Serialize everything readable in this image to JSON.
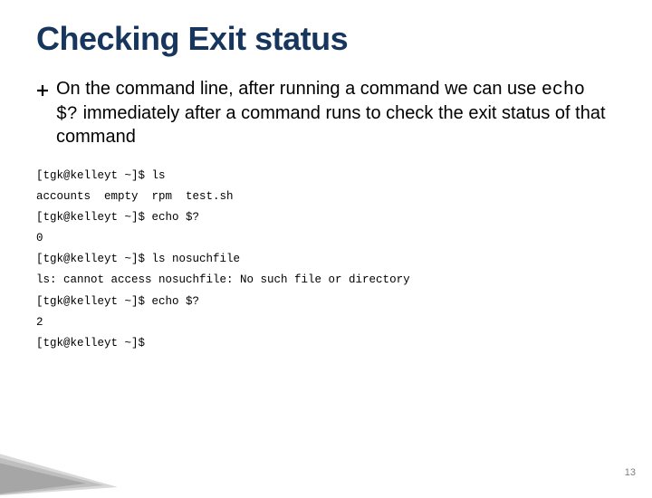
{
  "title": "Checking Exit status",
  "bullet": {
    "pre": "On the command line, after running a command we can use ",
    "code": "echo $?",
    "post": " immediately after a command runs to check the exit status of that command"
  },
  "terminal": [
    "[tgk@kelleyt ~]$ ls",
    "accounts  empty  rpm  test.sh",
    "[tgk@kelleyt ~]$ echo $?",
    "0",
    "[tgk@kelleyt ~]$ ls nosuchfile",
    "ls: cannot access nosuchfile: No such file or directory",
    "[tgk@kelleyt ~]$ echo $?",
    "2",
    "[tgk@kelleyt ~]$"
  ],
  "page_number": "13"
}
